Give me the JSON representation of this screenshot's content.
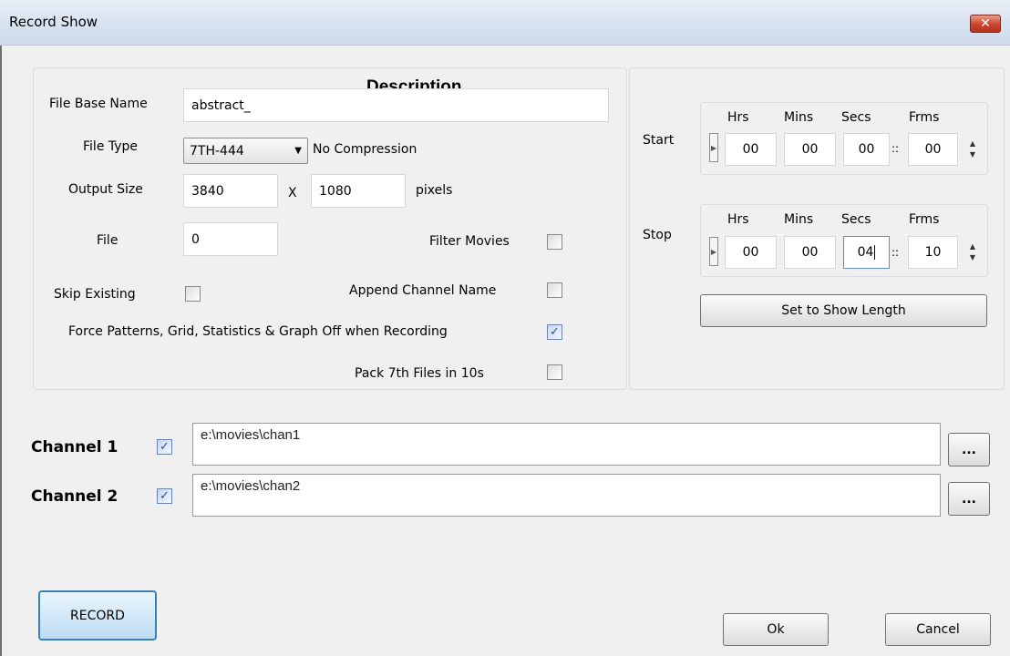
{
  "window": {
    "title": "Record Show",
    "close_glyph": "✕"
  },
  "description": "Description",
  "form": {
    "file_base_name": {
      "label": "File Base Name",
      "value": "abstract_"
    },
    "file_type": {
      "label": "File Type",
      "selected": "7TH-444",
      "compression": "No Compression"
    },
    "output_size": {
      "label": "Output Size",
      "width": "3840",
      "separator": "X",
      "height": "1080",
      "unit": "pixels"
    },
    "file": {
      "label": "File",
      "value": "0"
    },
    "filter_movies": {
      "label": "Filter Movies",
      "checked": false
    },
    "skip_existing": {
      "label": "Skip Existing",
      "checked": false
    },
    "append_channel_name": {
      "label": "Append Channel Name",
      "checked": false
    },
    "force_off": {
      "label": "Force Patterns, Grid, Statistics & Graph Off when Recording",
      "checked": true
    },
    "pack_files": {
      "label": "Pack 7th Files in 10s",
      "checked": false
    }
  },
  "timecode": {
    "headers": {
      "hrs": "Hrs",
      "mins": "Mins",
      "secs": "Secs",
      "frms": "Frms"
    },
    "separator": "::",
    "start": {
      "label": "Start",
      "hrs": "00",
      "mins": "00",
      "secs": "00",
      "frms": "00"
    },
    "stop": {
      "label": "Stop",
      "hrs": "00",
      "mins": "00",
      "secs": "04",
      "frms": "10"
    },
    "set_length_label": "Set to Show Length"
  },
  "channels": [
    {
      "label": "Channel 1",
      "checked": true,
      "path": "e:\\movies\\chan1",
      "browse_label": "..."
    },
    {
      "label": "Channel 2",
      "checked": true,
      "path": "e:\\movies\\chan2",
      "browse_label": "..."
    }
  ],
  "buttons": {
    "record": "RECORD",
    "ok": "Ok",
    "cancel": "Cancel"
  },
  "icons": {
    "dropdown": "chevron-down-icon",
    "spinner_up": "▲",
    "spinner_down": "▼",
    "check_mark": "✓",
    "handle_glyph": "▶"
  }
}
